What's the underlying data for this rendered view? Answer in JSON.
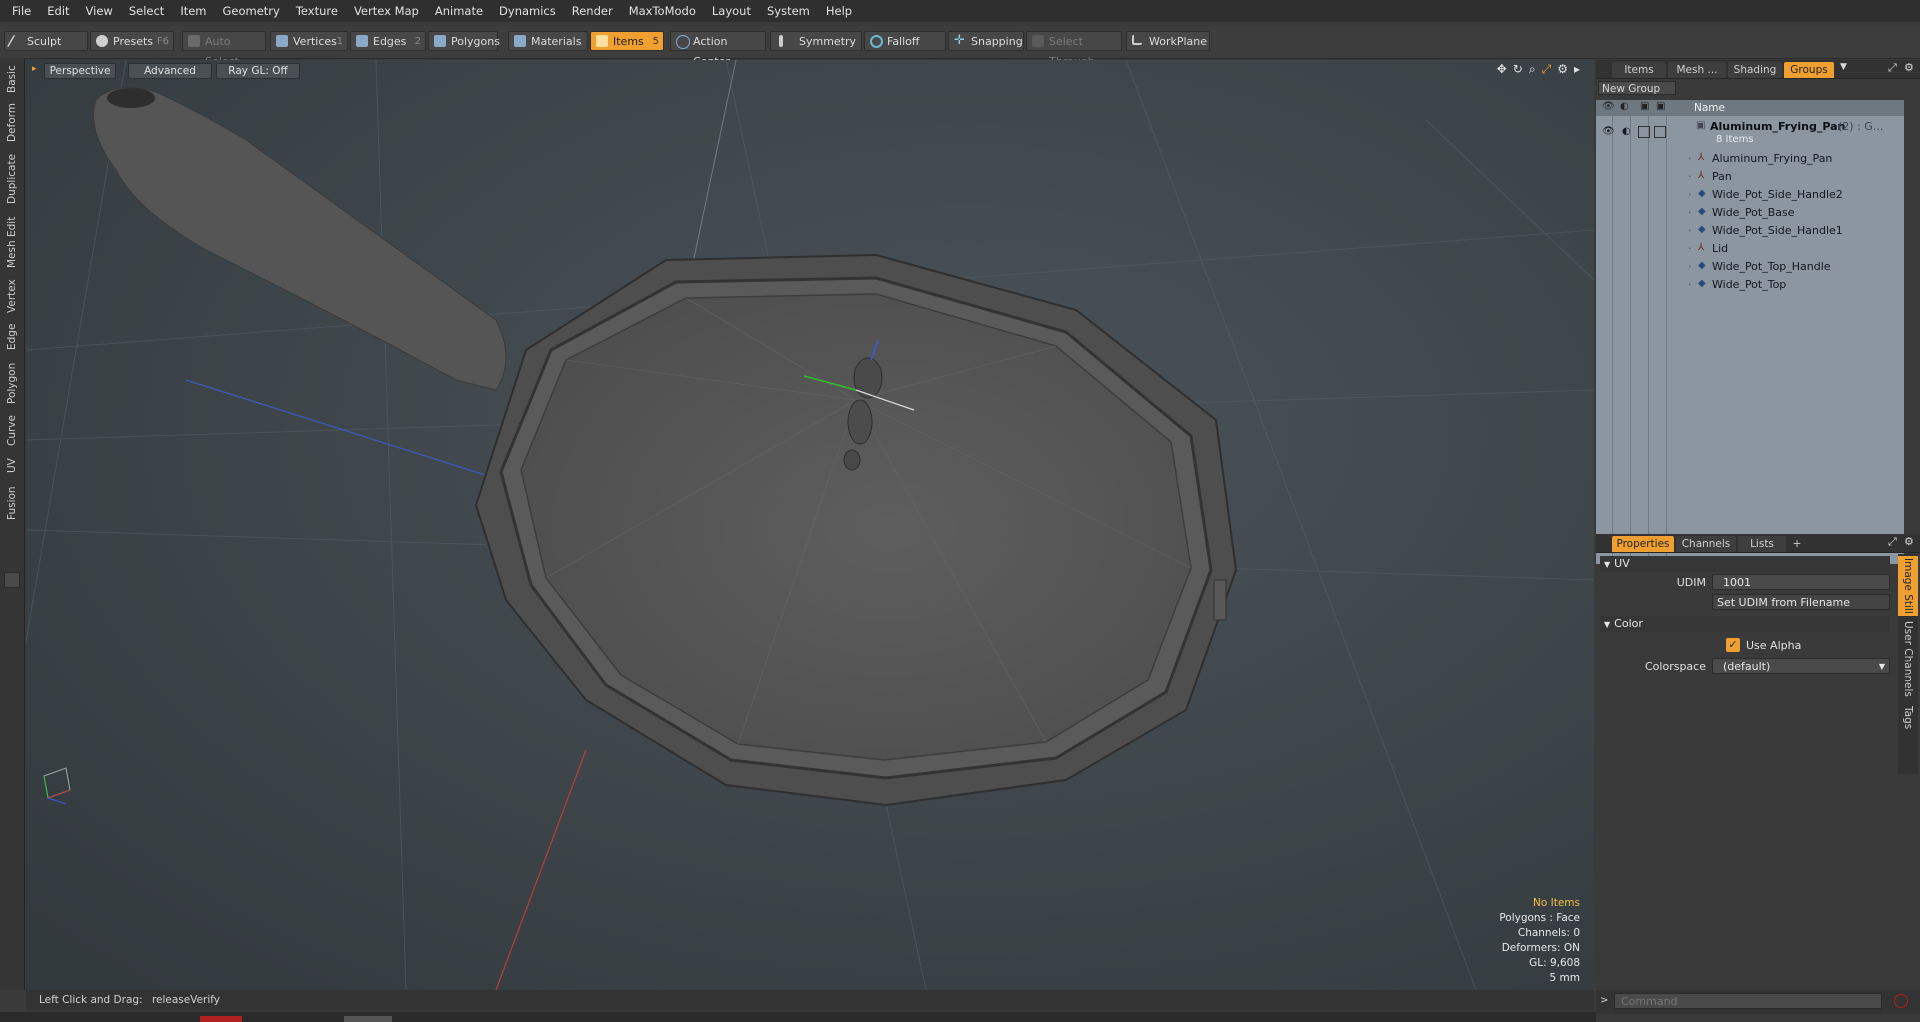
{
  "menu": [
    "File",
    "Edit",
    "View",
    "Select",
    "Item",
    "Geometry",
    "Texture",
    "Vertex Map",
    "Animate",
    "Dynamics",
    "Render",
    "MaxToModo",
    "Layout",
    "System",
    "Help"
  ],
  "toolbar": {
    "sculpt": "Sculpt",
    "presets": "Presets",
    "presets_key": "F6",
    "auto_select": "Auto Select",
    "vertices": "Vertices",
    "vertices_key": "1",
    "edges": "Edges",
    "edges_key": "2",
    "polygons": "Polygons",
    "materials": "Materials",
    "items": "Items",
    "items_key": "5",
    "action_center": "Action Center",
    "symmetry": "Symmetry",
    "falloff": "Falloff",
    "snapping": "Snapping",
    "select_through": "Select Through",
    "workplane": "WorkPlane"
  },
  "left_tabs": [
    "Basic",
    "Deform",
    "Duplicate",
    "Mesh Edit",
    "Vertex",
    "Edge",
    "Polygon",
    "Curve",
    "UV",
    "Fusion"
  ],
  "viewport": {
    "view_mode": "Perspective",
    "shading": "Advanced",
    "raygl": "Ray GL: Off",
    "hud": {
      "selection": "No Items",
      "polygons": "Polygons : Face",
      "channels": "Channels: 0",
      "deformers": "Deformers: ON",
      "gl": "GL: 9,608",
      "unit": "5 mm"
    }
  },
  "status": {
    "hint_label": "Left Click and Drag:",
    "hint_value": "releaseVerify",
    "command_placeholder": "Command"
  },
  "right_panel": {
    "top_tabs": [
      "Items",
      "Mesh ...",
      "Shading",
      "Groups"
    ],
    "active_top_tab": "Groups",
    "new_group": "New Group",
    "name_header": "Name",
    "group": {
      "name": "Aluminum_Frying_Pan",
      "suffix": "(2) : G...",
      "count": "8 Items",
      "children": [
        {
          "name": "Aluminum_Frying_Pan",
          "icon": "locator-icon"
        },
        {
          "name": "Pan",
          "icon": "locator-icon"
        },
        {
          "name": "Wide_Pot_Side_Handle2",
          "icon": "mesh-icon"
        },
        {
          "name": "Wide_Pot_Base",
          "icon": "mesh-icon"
        },
        {
          "name": "Wide_Pot_Side_Handle1",
          "icon": "mesh-icon"
        },
        {
          "name": "Lid",
          "icon": "locator-icon"
        },
        {
          "name": "Wide_Pot_Top_Handle",
          "icon": "mesh-icon"
        },
        {
          "name": "Wide_Pot_Top",
          "icon": "mesh-icon"
        }
      ]
    },
    "bottom_tabs": [
      "Properties",
      "Channels",
      "Lists",
      "+"
    ],
    "side_tabs": [
      "Image Still",
      "User Channels",
      "Tags"
    ],
    "uv_section": "UV",
    "udim_label": "UDIM",
    "udim_value": "1001",
    "set_udim": "Set UDIM from Filename",
    "color_section": "Color",
    "use_alpha": "Use Alpha",
    "colorspace_label": "Colorspace",
    "colorspace_value": "(default)"
  },
  "colors": {
    "accent": "#f0a030",
    "viewport_bg": "#3c4449",
    "tree_bg": "#8b96a0"
  }
}
